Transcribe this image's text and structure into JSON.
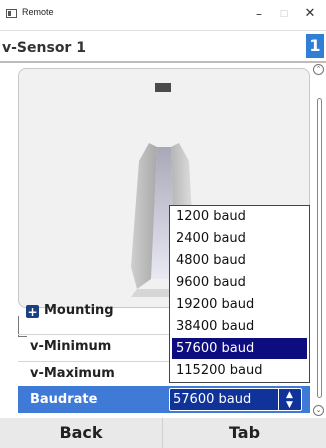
{
  "window": {
    "title": "Remote",
    "minimize_label": "–",
    "maximize_label": "□",
    "close_label": "✕"
  },
  "header": {
    "title": "v-Sensor 1",
    "page_number": "1"
  },
  "scrollbar": {
    "up_label": "⌃",
    "down_label": "⌄"
  },
  "group": {
    "label": "Mounting",
    "expand_symbol": "+"
  },
  "params": {
    "min_label": "v-Minimum",
    "max_label": "v-Maximum",
    "baud_label": "Baudrate",
    "baud_value": "57600 baud",
    "chevron": "▲\n▼"
  },
  "dropdown": {
    "options": [
      "1200 baud",
      "2400 baud",
      "4800 baud",
      "9600 baud",
      "19200 baud",
      "38400 baud",
      "57600 baud",
      "115200 baud"
    ],
    "selected_index": 6
  },
  "footer": {
    "back_label": "Back",
    "tab_label": "Tab"
  },
  "colors": {
    "header_badge": "#2f7fd6",
    "selected_row": "#3f7ad6",
    "select_bg": "#10339a",
    "dropdown_highlight": "#0d0d7f"
  }
}
